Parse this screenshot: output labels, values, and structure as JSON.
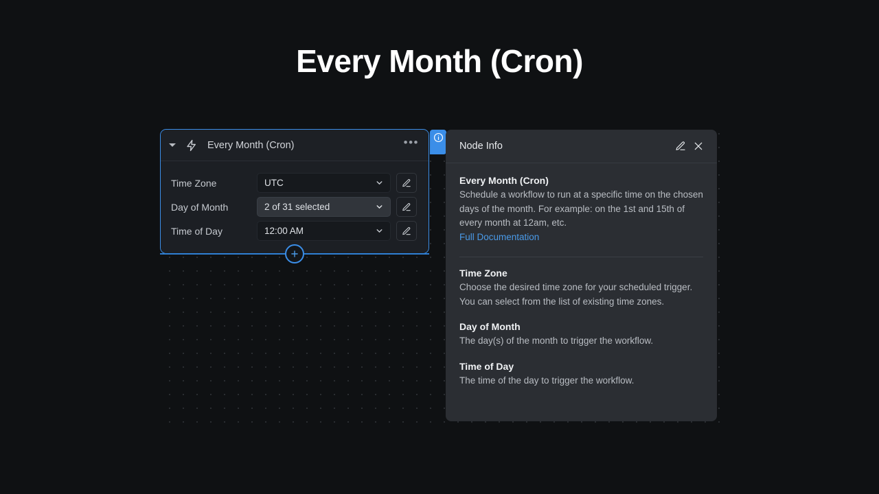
{
  "page": {
    "title": "Every Month (Cron)"
  },
  "node": {
    "title": "Every Month (Cron)",
    "collapse_icon": "chevron-down-icon",
    "type_icon": "lightning-bolt-icon",
    "menu_label": "•••",
    "fields": [
      {
        "label": "Time Zone",
        "value": "UTC",
        "highlighted": false
      },
      {
        "label": "Day of Month",
        "value": "2 of 31 selected",
        "highlighted": true
      },
      {
        "label": "Time of Day",
        "value": "12:00 AM",
        "highlighted": false
      }
    ],
    "add_button_label": "+"
  },
  "info_panel": {
    "badge_icon": "info-circle-icon",
    "header": {
      "title": "Node Info",
      "edit_icon": "pencil-icon",
      "close_icon": "close-icon"
    },
    "sections": [
      {
        "title": "Every Month (Cron)",
        "text": "Schedule a workflow to run at a specific time on the chosen days of the month. For example: on the 1st and 15th of every month at 12am, etc.",
        "link": "Full Documentation"
      },
      {
        "title": "Time Zone",
        "text": "Choose the desired time zone for your scheduled trigger. You can select from the list of existing time zones."
      },
      {
        "title": "Day of Month",
        "text": "The day(s) of the month to trigger the workflow."
      },
      {
        "title": "Time of Day",
        "text": "The time of the day to trigger the workflow."
      }
    ]
  },
  "colors": {
    "background": "#0f1113",
    "accent_blue": "#3b8ee8",
    "link_blue": "#4a9ae8",
    "node_surface": "#1c1f24",
    "panel_surface": "#2b2e33"
  }
}
